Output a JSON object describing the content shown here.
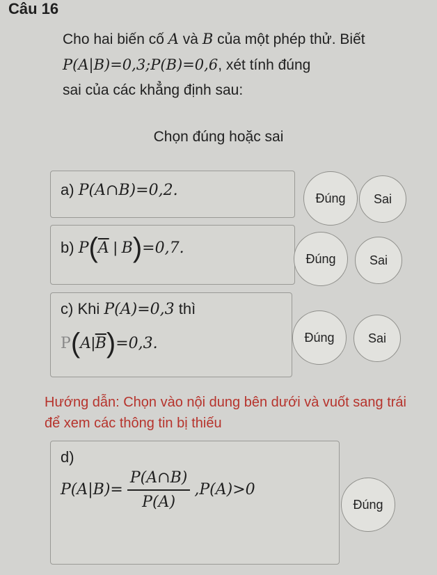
{
  "question": {
    "title": "Câu 16",
    "intro_line1_text": "Cho hai biến cố ",
    "intro_A": "A",
    "intro_and": " và ",
    "intro_B": "B",
    "intro_line1_end": " của một phép thử. Biết",
    "intro_formula": "P(A|B)=0,3;P(B)=0,6",
    "intro_line2_end": ", xét tính đúng",
    "intro_line3": "sai của các khẳng định sau:"
  },
  "instruction": "Chọn đúng hoặc sai",
  "statements": {
    "a": {
      "label": "a)",
      "formula": "P(A∩B)=0,2."
    },
    "b": {
      "label": "b)",
      "formula_pre": "P",
      "formula_mid_A": "A",
      "formula_mid_B": "B",
      "formula_post": "=0,7."
    },
    "c": {
      "label": "c) Khi",
      "formula1": "P(A)=0,3",
      "then": "thì",
      "formula2_A": "A",
      "formula2_B": "B",
      "formula2_post": "=0,3."
    },
    "d": {
      "label": "d)",
      "lhs": "P(A|B)=",
      "num": "P(A∩B)",
      "den": "P(A)",
      "rhs": ",P(A)>0"
    }
  },
  "buttons": {
    "dung": "Đúng",
    "sai": "Sai"
  },
  "guide": "Hướng dẫn: Chọn vào nội dung bên dưới và vuốt sang trái để xem các thông tin bị thiếu"
}
